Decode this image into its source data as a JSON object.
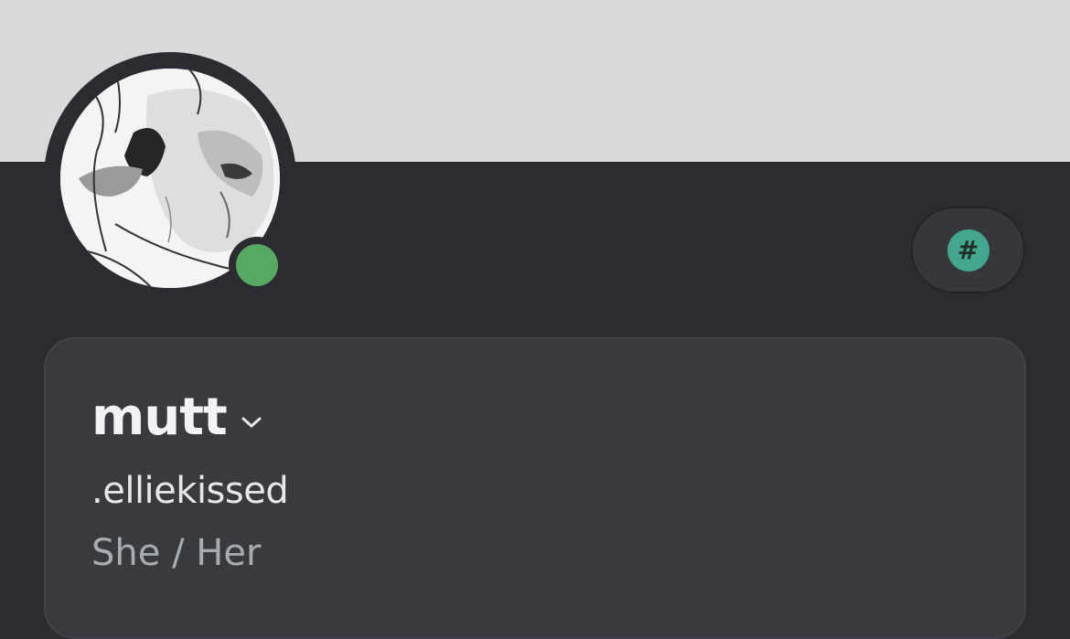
{
  "profile": {
    "display_name": "mutt",
    "username": ".elliekissed",
    "pronouns": "She / Her",
    "status": "online",
    "avatar_icon": "avatar-image",
    "expand_icon": "chevron-down-icon"
  },
  "badge": {
    "icon": "hash-icon",
    "glyph": "#"
  },
  "colors": {
    "banner": "#d9d9d9",
    "background": "#2b2c31",
    "card": "#393a40",
    "status_online": "#57a862",
    "badge_accent": "#45a68e"
  }
}
